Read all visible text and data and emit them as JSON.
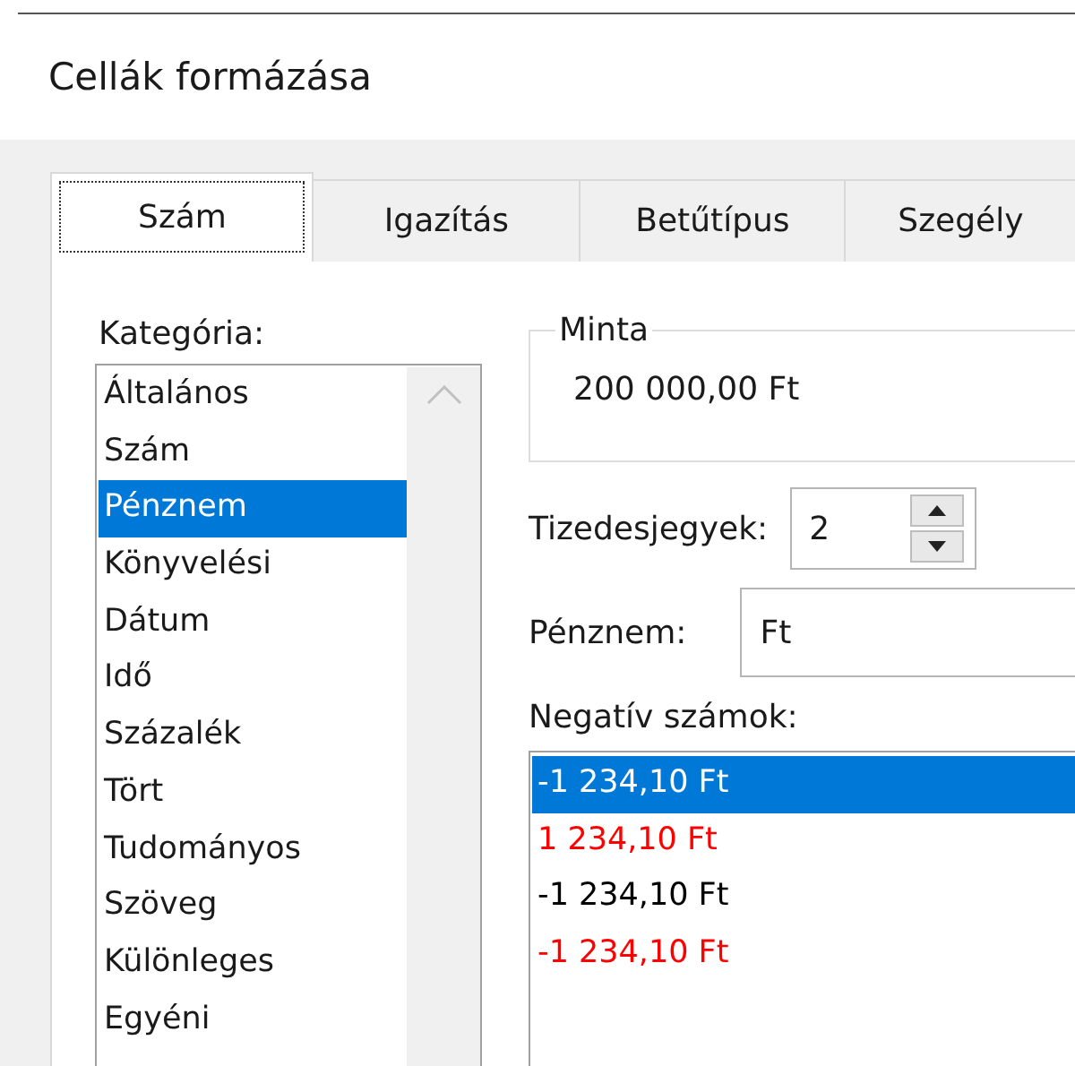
{
  "window": {
    "title": "Cellák formázása"
  },
  "tabs": [
    {
      "label": "Szám",
      "selected": true
    },
    {
      "label": "Igazítás",
      "selected": false
    },
    {
      "label": "Betűtípus",
      "selected": false
    },
    {
      "label": "Szegély",
      "selected": false
    }
  ],
  "category": {
    "label": "Kategória:",
    "items": [
      {
        "label": "Általános",
        "selected": false
      },
      {
        "label": "Szám",
        "selected": false
      },
      {
        "label": "Pénznem",
        "selected": true
      },
      {
        "label": "Könyvelési",
        "selected": false
      },
      {
        "label": "Dátum",
        "selected": false
      },
      {
        "label": "Idő",
        "selected": false
      },
      {
        "label": "Százalék",
        "selected": false
      },
      {
        "label": "Tört",
        "selected": false
      },
      {
        "label": "Tudományos",
        "selected": false
      },
      {
        "label": "Szöveg",
        "selected": false
      },
      {
        "label": "Különleges",
        "selected": false
      },
      {
        "label": "Egyéni",
        "selected": false
      }
    ]
  },
  "sample": {
    "label": "Minta",
    "value": "200 000,00 Ft"
  },
  "decimals": {
    "label": "Tizedesjegyek:",
    "value": "2"
  },
  "currency": {
    "label": "Pénznem:",
    "value": "Ft"
  },
  "negative_numbers": {
    "label": "Negatív számok:",
    "items": [
      {
        "label": "-1 234,10 Ft",
        "selected": true
      },
      {
        "label": "1 234,10 Ft",
        "color": "#ff0000",
        "selected": false
      },
      {
        "label": "-1 234,10 Ft",
        "color": "#000000",
        "selected": false
      },
      {
        "label": "-1 234,10 Ft",
        "color": "#ff0000",
        "selected": false
      }
    ]
  }
}
